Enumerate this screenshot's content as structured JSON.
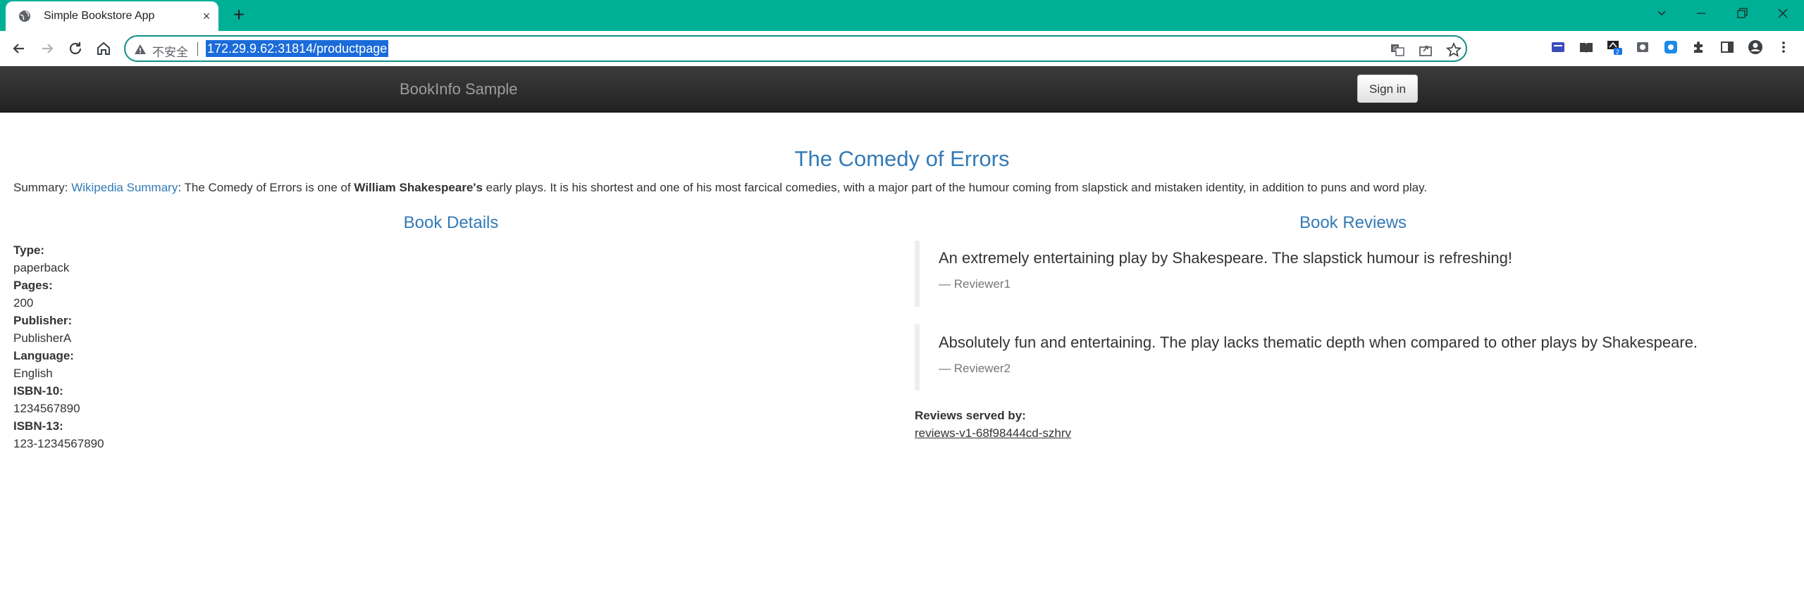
{
  "browser": {
    "tab_title": "Simple Bookstore App",
    "tab_close": "×",
    "new_tab": "+",
    "insecure_label": "不安全",
    "url": "172.29.9.62:31814/productpage",
    "extension_badge": "2"
  },
  "navbar": {
    "brand": "BookInfo Sample",
    "signin_label": "Sign in"
  },
  "book": {
    "title": "The Comedy of Errors",
    "summary_label": "Summary: ",
    "summary_link": "Wikipedia Summary",
    "summary_pre": ": The Comedy of Errors is one of ",
    "summary_bold": "William Shakespeare's",
    "summary_post": " early plays. It is his shortest and one of his most farcical comedies, with a major part of the humour coming from slapstick and mistaken identity, in addition to puns and word play."
  },
  "details": {
    "heading": "Book Details",
    "fields": [
      {
        "label": "Type:",
        "value": "paperback"
      },
      {
        "label": "Pages:",
        "value": "200"
      },
      {
        "label": "Publisher:",
        "value": "PublisherA"
      },
      {
        "label": "Language:",
        "value": "English"
      },
      {
        "label": "ISBN-10:",
        "value": "1234567890"
      },
      {
        "label": "ISBN-13:",
        "value": "123-1234567890"
      }
    ]
  },
  "reviews": {
    "heading": "Book Reviews",
    "items": [
      {
        "text": "An extremely entertaining play by Shakespeare. The slapstick humour is refreshing!",
        "author": "— Reviewer1"
      },
      {
        "text": "Absolutely fun and entertaining. The play lacks thematic depth when compared to other plays by Shakespeare.",
        "author": "— Reviewer2"
      }
    ],
    "served_by_label": "Reviews served by:",
    "served_by_link": "reviews-v1-68f98444cd-szhrv"
  },
  "colors": {
    "tab_strip": "#00b096",
    "link": "#337ab7",
    "navbar": "#222222"
  }
}
